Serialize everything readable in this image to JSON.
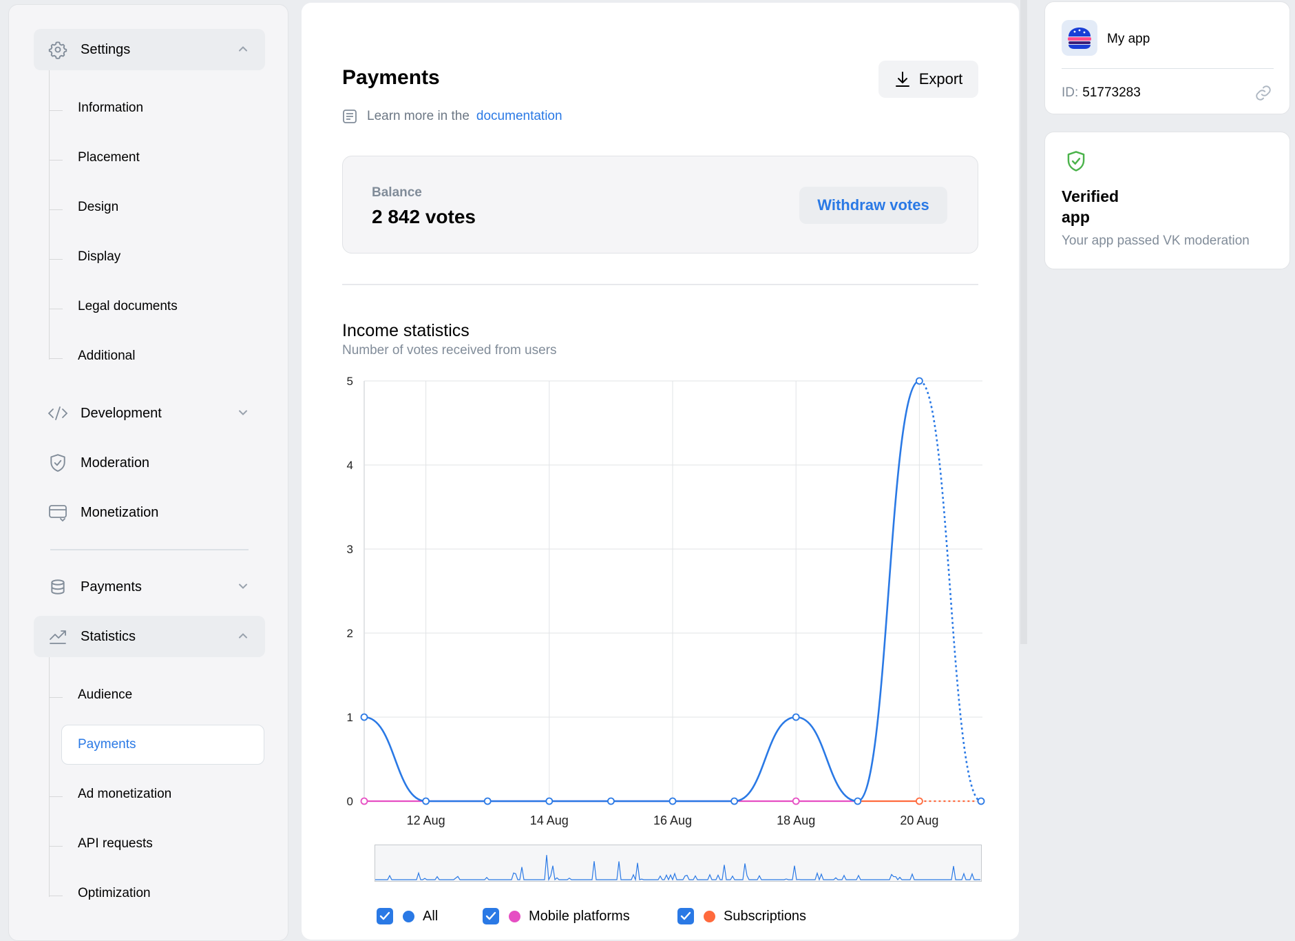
{
  "sidebar": {
    "settings": {
      "label": "Settings",
      "items": [
        "Information",
        "Placement",
        "Design",
        "Display",
        "Legal documents",
        "Additional"
      ]
    },
    "development": "Development",
    "moderation": "Moderation",
    "monetization": "Monetization",
    "payments": "Payments",
    "statistics": {
      "label": "Statistics",
      "items": [
        "Audience",
        "Payments",
        "Ad monetization",
        "API requests",
        "Optimization"
      ]
    }
  },
  "main": {
    "title": "Payments",
    "export_label": "Export",
    "learn_prefix": "Learn more in the",
    "learn_link": "documentation",
    "balance": {
      "label": "Balance",
      "value": "2 842 votes",
      "withdraw_label": "Withdraw votes"
    },
    "income": {
      "title": "Income statistics",
      "subtitle": "Number of votes received from users"
    }
  },
  "app_card": {
    "name": "My app",
    "id_label": "ID:",
    "id_value": "51773283"
  },
  "verified_card": {
    "title": "Verified app",
    "subtitle": "Your app passed VK moderation"
  },
  "colors": {
    "accent": "#2a79e5",
    "all": "#2a79e5",
    "mobile": "#e64ec3",
    "subscriptions": "#ff6a3d",
    "verified": "#4bb34b"
  },
  "chart_data": {
    "type": "line",
    "x": [
      "11 Aug",
      "12 Aug",
      "13 Aug",
      "14 Aug",
      "15 Aug",
      "16 Aug",
      "17 Aug",
      "18 Aug",
      "19 Aug",
      "20 Aug",
      "21 Aug"
    ],
    "x_tick_labels": [
      "12 Aug",
      "14 Aug",
      "16 Aug",
      "18 Aug",
      "20 Aug"
    ],
    "y_ticks": [
      0,
      1,
      2,
      3,
      4,
      5
    ],
    "ylim": [
      0,
      5
    ],
    "grid": true,
    "series": [
      {
        "name": "All",
        "values": [
          1,
          0,
          0,
          0,
          0,
          0,
          0,
          1,
          0,
          5,
          0
        ]
      },
      {
        "name": "Mobile platforms",
        "values": [
          0,
          0,
          0,
          0,
          0,
          0,
          0,
          0,
          0,
          0,
          0
        ]
      },
      {
        "name": "Subscriptions",
        "values": [
          0,
          0,
          0,
          0,
          0,
          0,
          0,
          0,
          0,
          0,
          0
        ]
      }
    ],
    "last_point_incomplete": true
  }
}
